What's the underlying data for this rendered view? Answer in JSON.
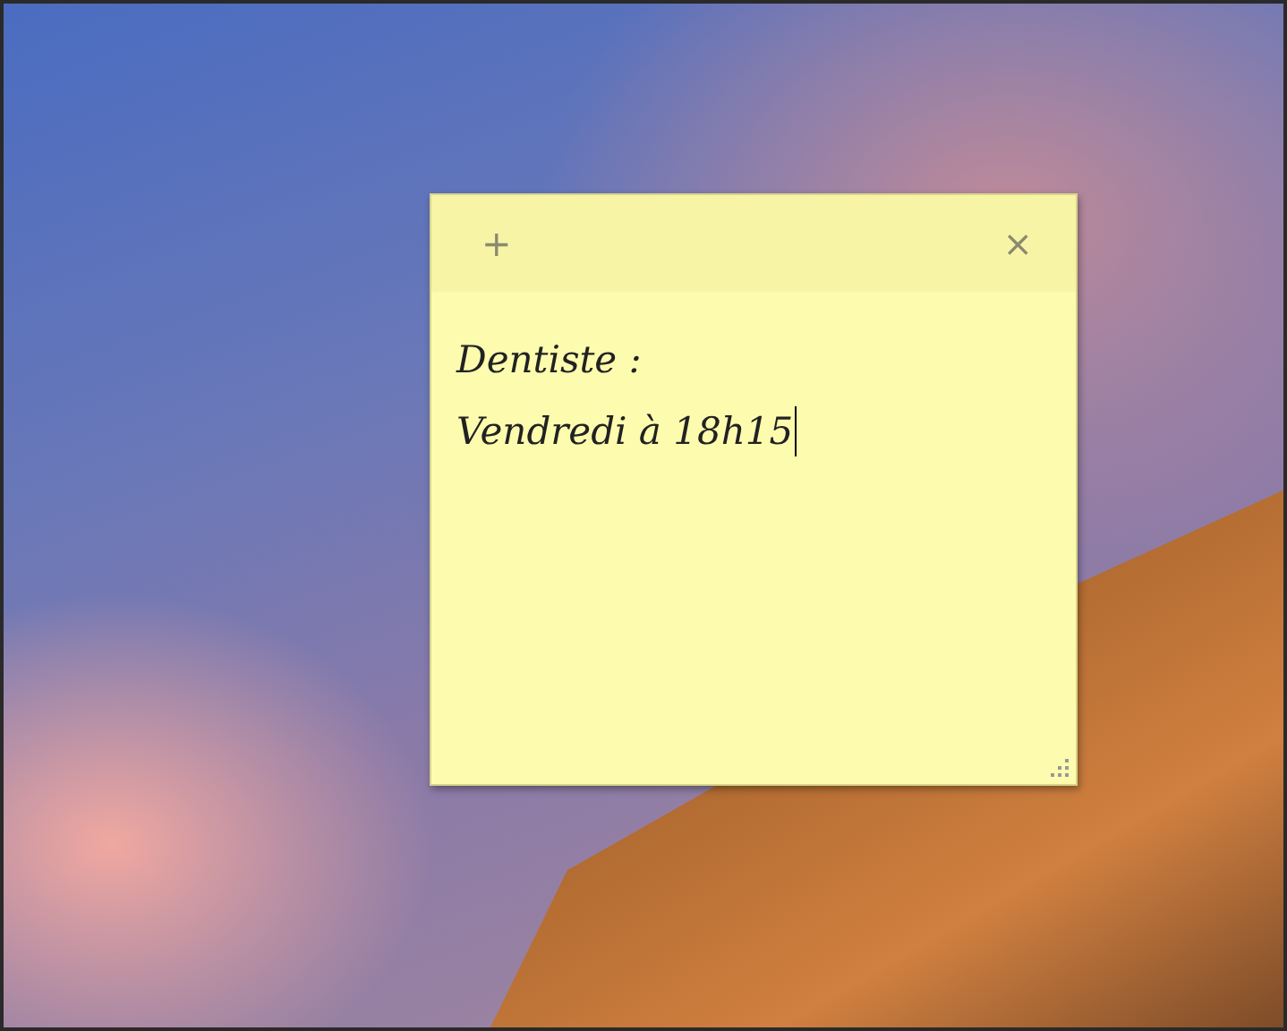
{
  "note": {
    "add_symbol": "+",
    "close_symbol": "×",
    "lines": [
      "Dentiste :",
      "Vendredi à 18h15"
    ]
  }
}
